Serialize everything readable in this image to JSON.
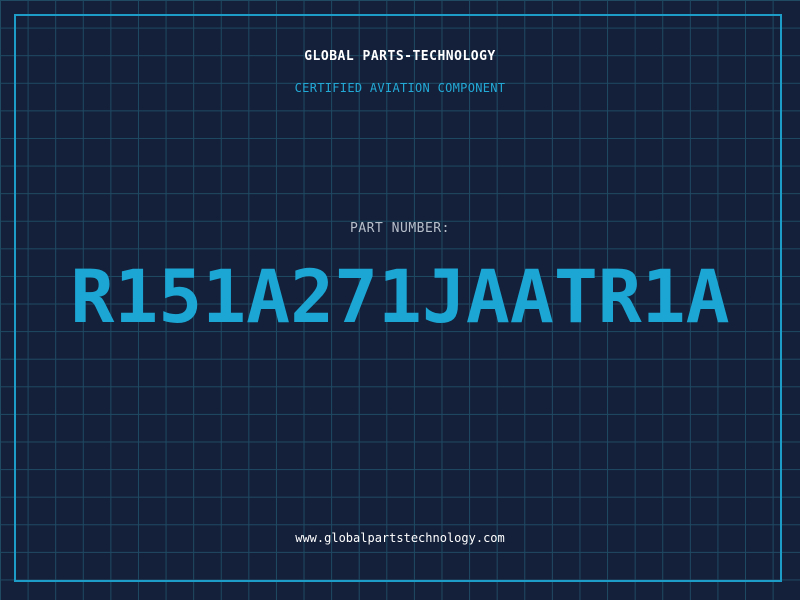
{
  "header": {
    "brand": "GLOBAL PARTS-TECHNOLOGY",
    "subtitle": "CERTIFIED AVIATION COMPONENT"
  },
  "part": {
    "label": "PART NUMBER:",
    "number": "R151A271JAATR1A"
  },
  "footer": {
    "url": "www.globalpartstechnology.com"
  },
  "colors": {
    "background": "#14203a",
    "grid": "#1f4a63",
    "accent": "#1ba6d4",
    "border": "#1e9cc8",
    "text": "#ffffff",
    "muted_text": "#b7bfca"
  }
}
